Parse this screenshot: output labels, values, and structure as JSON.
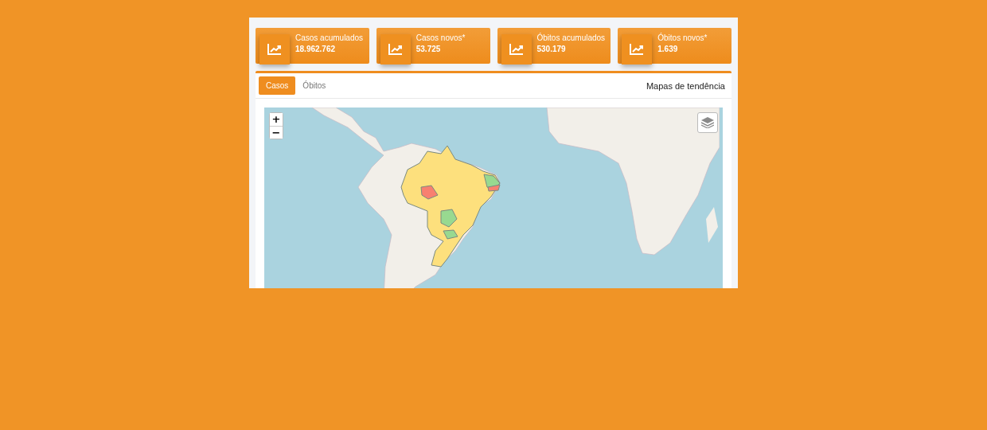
{
  "cards": [
    {
      "label": "Casos acumulados",
      "value": "18.962.762"
    },
    {
      "label": "Casos novos*",
      "value": "53.725"
    },
    {
      "label": "Óbitos acumulados",
      "value": "530.179"
    },
    {
      "label": "Óbitos novos*",
      "value": "1.639"
    }
  ],
  "tabs": [
    {
      "label": "Casos",
      "selected": true
    },
    {
      "label": "Óbitos",
      "selected": false
    }
  ],
  "panel_title": "Mapas de tendência",
  "map": {
    "zoom_in": "+",
    "zoom_out": "−"
  }
}
